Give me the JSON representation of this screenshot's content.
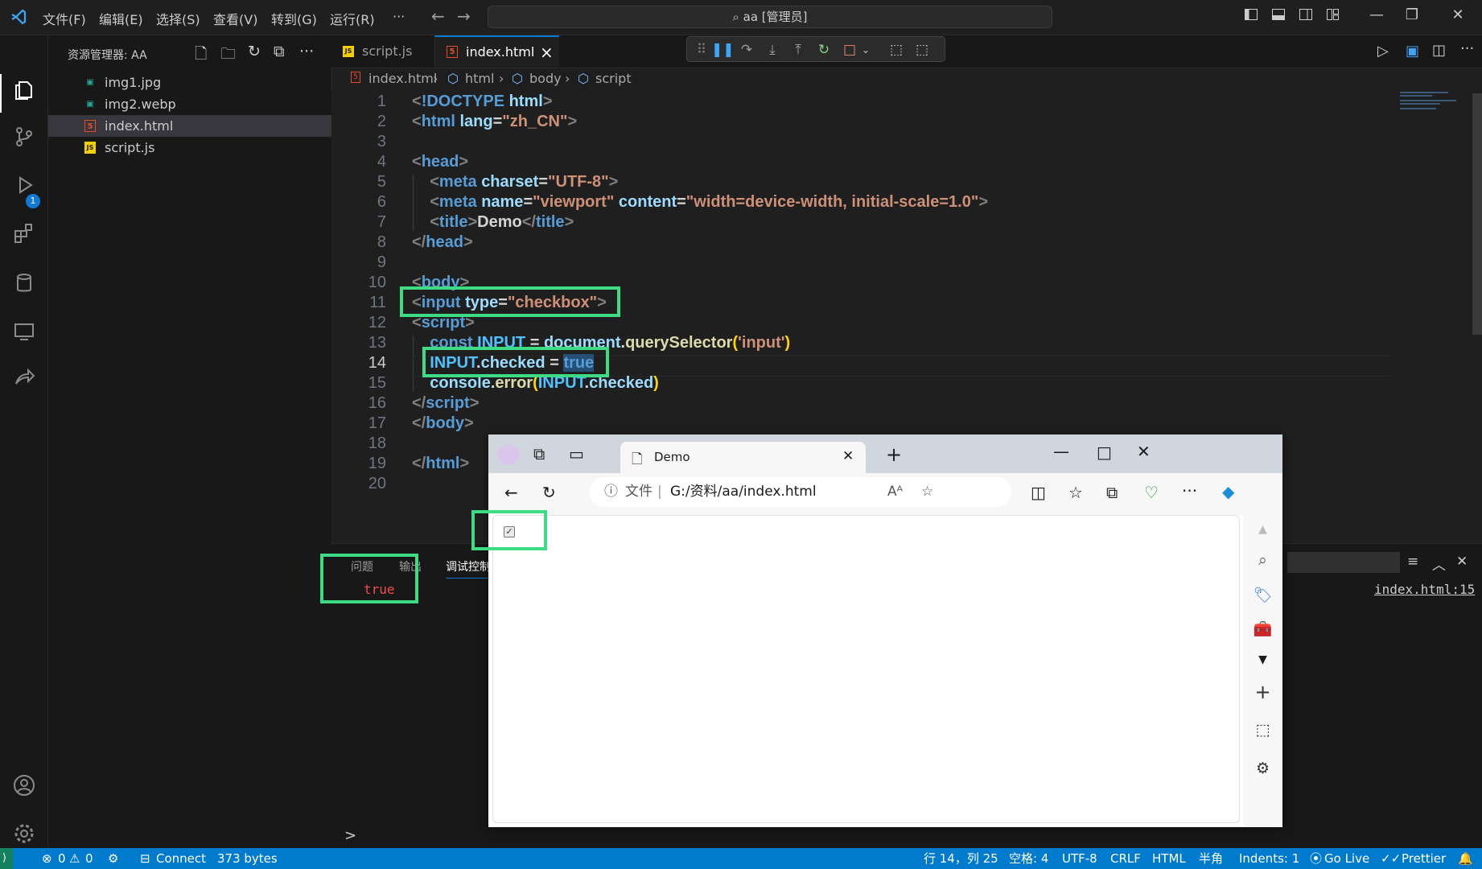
{
  "titlebar": {
    "menus": [
      "文件(F)",
      "编辑(E)",
      "选择(S)",
      "查看(V)",
      "转到(G)",
      "运行(R)",
      "···"
    ],
    "command_center": "aa [管理员]"
  },
  "sidebar": {
    "title": "资源管理器: AA",
    "files": [
      {
        "name": "img1.jpg",
        "icon": "image-file-icon"
      },
      {
        "name": "img2.webp",
        "icon": "image-file-icon"
      },
      {
        "name": "index.html",
        "icon": "html-file-icon"
      },
      {
        "name": "script.js",
        "icon": "js-file-icon"
      }
    ],
    "debug_badge": "1"
  },
  "tabs": [
    {
      "label": "script.js",
      "icon": "JS"
    },
    {
      "label": "index.html",
      "icon": "5",
      "close": "×"
    }
  ],
  "breadcrumb": [
    "index.html",
    "html",
    "body",
    "script"
  ],
  "editor": {
    "line_numbers": [
      "1",
      "2",
      "3",
      "4",
      "5",
      "6",
      "7",
      "8",
      "9",
      "10",
      "11",
      "12",
      "13",
      "14",
      "15",
      "16",
      "17",
      "18",
      "19",
      "20"
    ],
    "current_line": "14"
  },
  "panel": {
    "tabs": [
      "问题",
      "输出",
      "调试控制"
    ],
    "console_value": "true",
    "source_link": "index.html:15",
    "prompt": ">"
  },
  "browser": {
    "tab_title": "Demo",
    "address_label": "文件",
    "address": "G:/资料/aa/index.html",
    "checkbox_checked": true
  },
  "statusbar": {
    "errors": "0",
    "warnings": "0",
    "connect": "Connect",
    "size": "373 bytes",
    "position": "行 14，列 25",
    "spaces": "空格: 4",
    "encoding": "UTF-8",
    "eol": "CRLF",
    "language": "HTML",
    "width_mode": "半角",
    "indents": "Indents: 1",
    "golive": "Go Live",
    "prettier": "Prettier"
  },
  "colors": {
    "accent": "#007acc",
    "highlight": "#3ddc84",
    "error_text": "#f14c4c"
  }
}
